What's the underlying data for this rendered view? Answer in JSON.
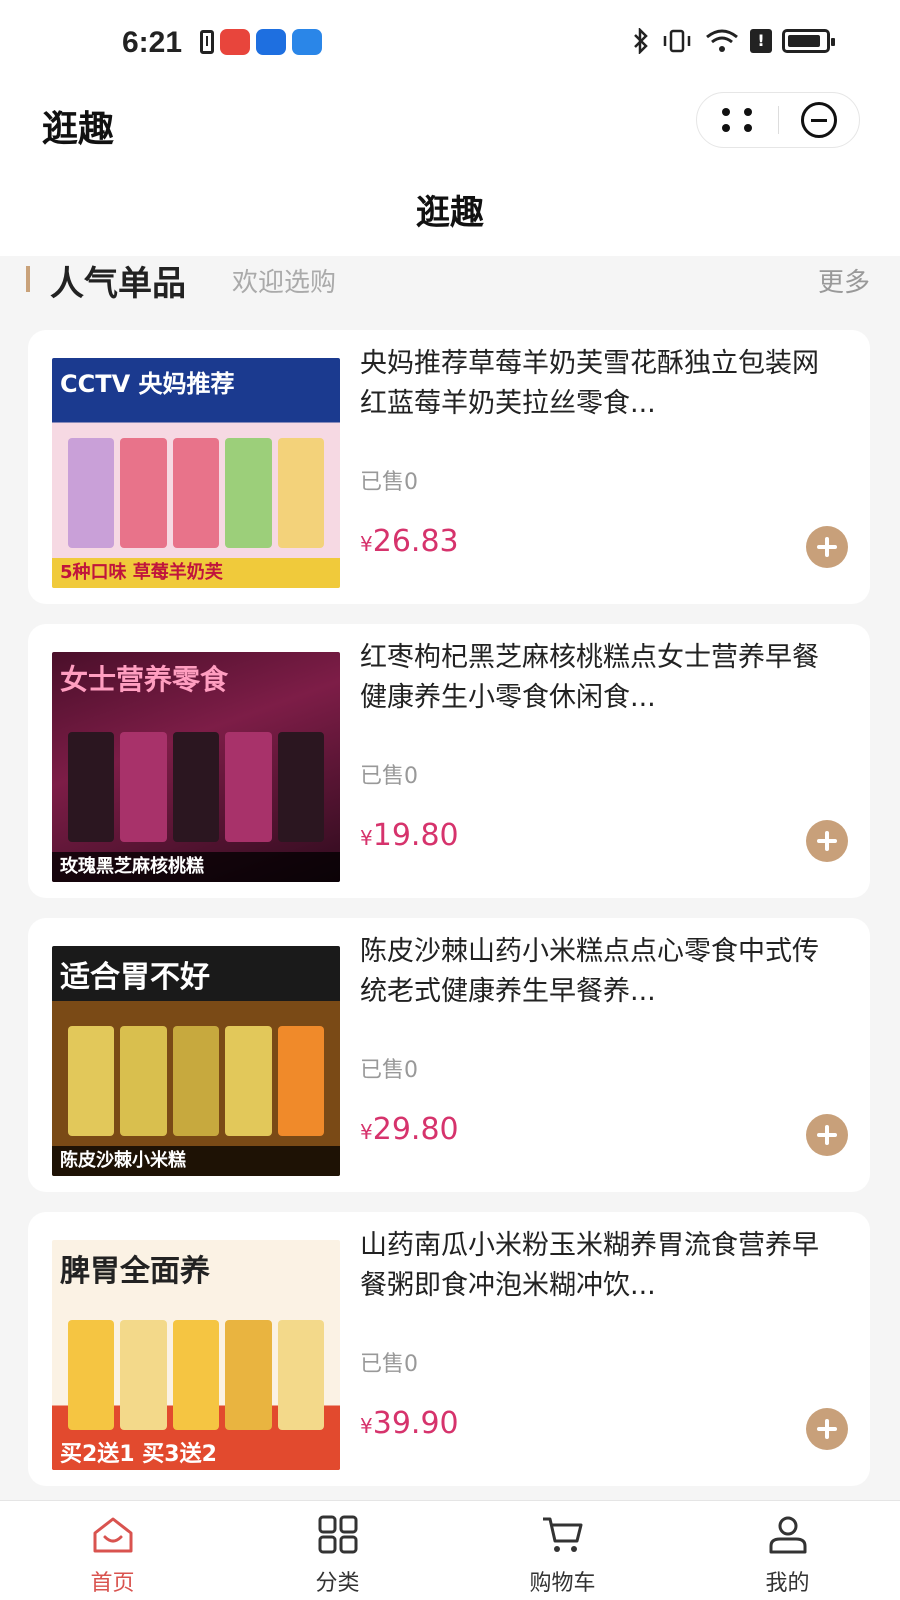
{
  "status_bar": {
    "time": "6:21",
    "signal_text": "✱ ≡"
  },
  "header": {
    "app_title": "逛趣",
    "page_heading": "逛趣"
  },
  "section": {
    "title": "人气单品",
    "subtitle": "欢迎选购",
    "more": "更多"
  },
  "products": [
    {
      "title": "央妈推荐草莓羊奶芙雪花酥独立包装网红蓝莓羊奶芙拉丝零食...",
      "sold": "已售0",
      "currency": "¥",
      "price": "26.83",
      "image_banner": "CCTV 央妈推荐",
      "image_caption": "5种口味 草莓羊奶芙"
    },
    {
      "title": "红枣枸杞黑芝麻核桃糕点女士营养早餐健康养生小零食休闲食...",
      "sold": "已售0",
      "currency": "¥",
      "price": "19.80",
      "image_banner": "女士营养零食",
      "image_caption": "玫瑰黑芝麻核桃糕"
    },
    {
      "title": "陈皮沙棘山药小米糕点点心零食中式传统老式健康养生早餐养...",
      "sold": "已售0",
      "currency": "¥",
      "price": "29.80",
      "image_banner": "适合胃不好",
      "image_caption": "陈皮沙棘小米糕"
    },
    {
      "title": "山药南瓜小米粉玉米糊养胃流食营养早餐粥即食冲泡米糊冲饮...",
      "sold": "已售0",
      "currency": "¥",
      "price": "39.90",
      "image_banner": "脾胃全面养",
      "image_caption": "买2送1 买3送2"
    }
  ],
  "tabs": [
    {
      "label": "首页",
      "icon": "home-icon",
      "active": true
    },
    {
      "label": "分类",
      "icon": "category-grid-icon",
      "active": false
    },
    {
      "label": "购物车",
      "icon": "cart-icon",
      "active": false
    },
    {
      "label": "我的",
      "icon": "user-icon",
      "active": false
    }
  ],
  "colors": {
    "accent": "#c8a07a",
    "price": "#d6336c",
    "active_tab": "#d9534f"
  }
}
